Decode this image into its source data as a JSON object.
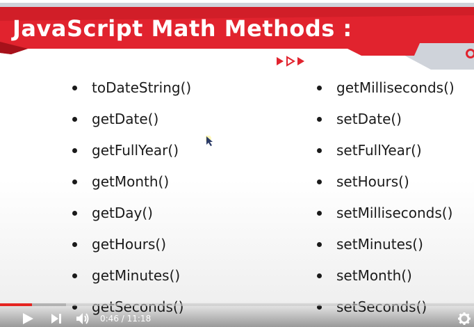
{
  "slide": {
    "title": "JavaScript Math Methods :",
    "left_items": [
      "toDateString()",
      "getDate()",
      "getFullYear()",
      "getMonth()",
      "getDay()",
      "getHours()",
      "getMinutes()",
      "getSeconds()"
    ],
    "right_items": [
      "getMilliseconds()",
      "setDate()",
      "setFullYear()",
      "setHours()",
      "setMilliseconds()",
      "setMinutes()",
      "setMonth()",
      "setSeconds()"
    ]
  },
  "player": {
    "time_display": "0:46 / 11:18",
    "progress": 0.068,
    "buffered": 0.14
  },
  "colors": {
    "accent": "#e1232e",
    "banner_dark": "#b0141c",
    "banner_grey": "#cfd3da"
  },
  "icons": [
    "play-icon",
    "next-icon",
    "volume-icon",
    "settings-gear-icon",
    "arrow-decoration-icon",
    "mouse-cursor-icon"
  ]
}
